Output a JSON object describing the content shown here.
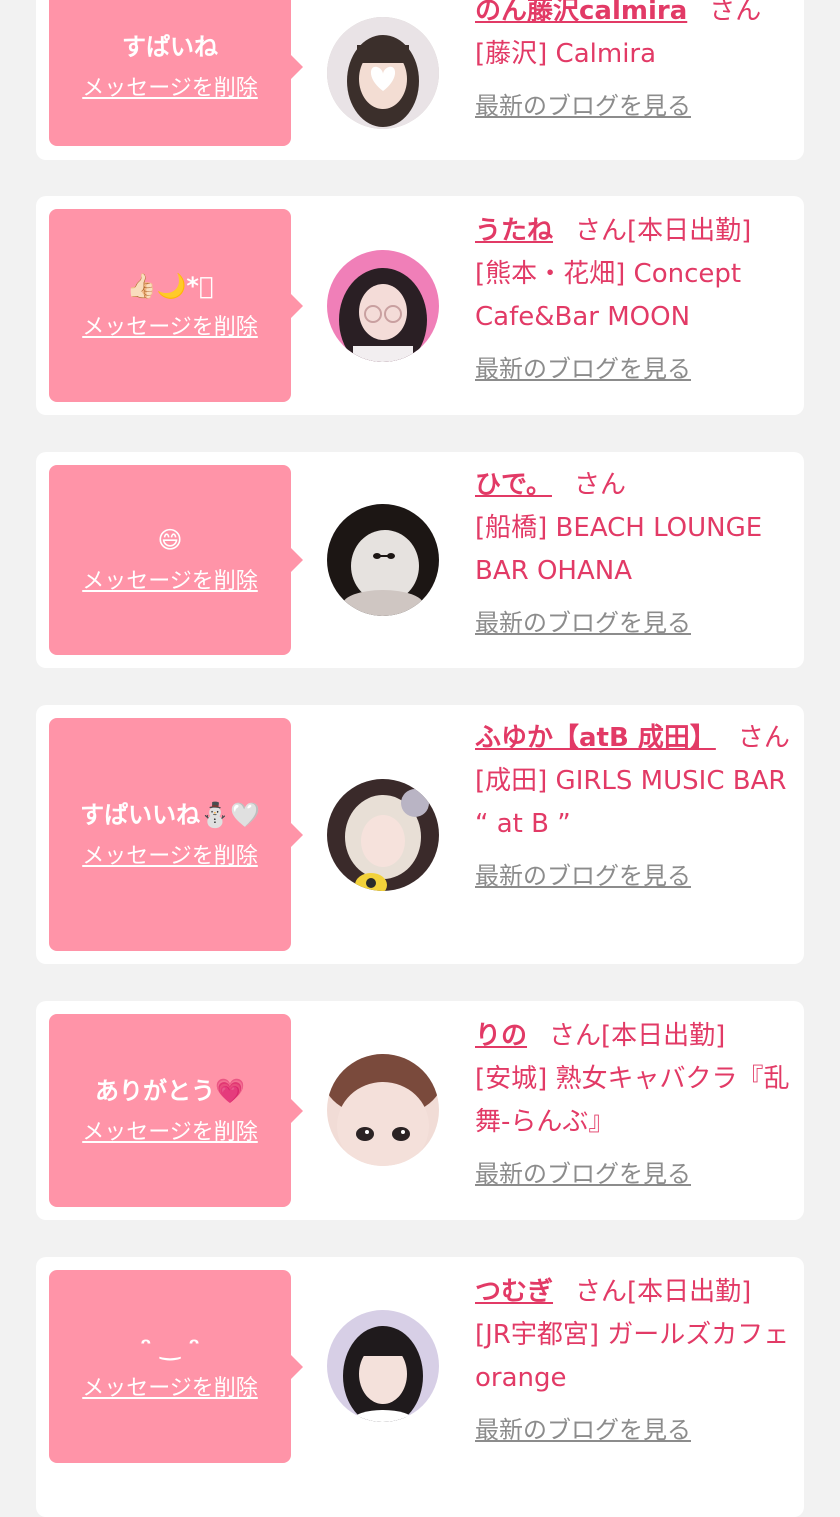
{
  "messages": [
    {
      "message": "すぱいね",
      "delete_label": "メッセージを削除",
      "name": "のん藤沢calmira",
      "suffix": "さん",
      "status": "",
      "shop": "[藤沢] Calmira",
      "blog_label": "最新のブログを見る"
    },
    {
      "message": "👍🏻🌙*ﾟ",
      "delete_label": "メッセージを削除",
      "name": "うたね",
      "suffix": "さん",
      "status": "[本日出勤]",
      "shop": "[熊本・花畑] Concept Cafe&Bar MOON",
      "blog_label": "最新のブログを見る"
    },
    {
      "message": "😄",
      "delete_label": "メッセージを削除",
      "name": "ひで。",
      "suffix": "さん",
      "status": "",
      "shop": "[船橋] BEACH LOUNGE BAR OHANA",
      "blog_label": "最新のブログを見る"
    },
    {
      "message": "すぱいいね⛄🤍",
      "delete_label": "メッセージを削除",
      "name": "ふゆか【atB 成田】",
      "suffix": "さん",
      "status": "",
      "shop": "[成田] GIRLS MUSIC BAR “ at B ”",
      "blog_label": "最新のブログを見る"
    },
    {
      "message": "ありがとう💗",
      "delete_label": "メッセージを削除",
      "name": "りの",
      "suffix": "さん",
      "status": "[本日出勤]",
      "shop": "[安城] 熟女キャバクラ『乱舞-らんぶ』",
      "blog_label": "最新のブログを見る"
    },
    {
      "message": "ᵔ ‿ ᵔ",
      "delete_label": "メッセージを削除",
      "name": "つむぎ",
      "suffix": "さん",
      "status": "[本日出勤]",
      "shop": "[JR宇都宮] ガールズカフェ orange",
      "blog_label": "最新のブログを見る"
    }
  ]
}
